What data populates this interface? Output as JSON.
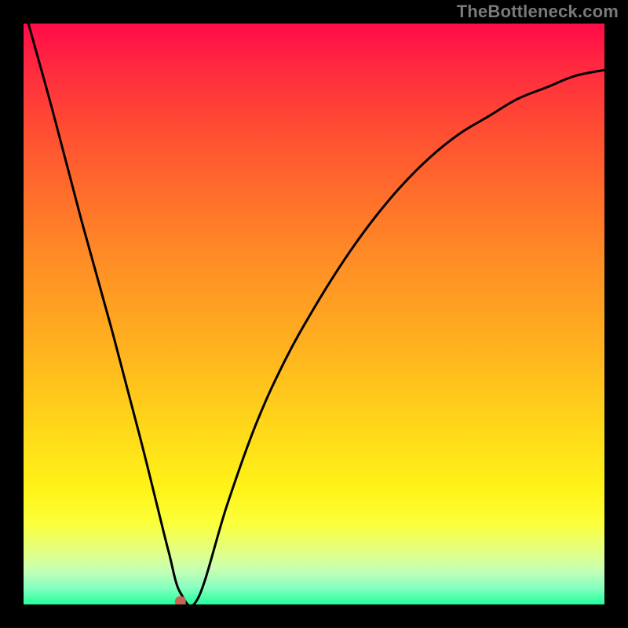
{
  "watermark": "TheBottleneck.com",
  "colors": {
    "background": "#000000",
    "curve": "#000000",
    "marker": "#c96255",
    "watermark_text": "#7a7a7a",
    "gradient_stops": [
      "#ff0b49",
      "#ff2b3f",
      "#ff4934",
      "#ff6a2c",
      "#ff8b26",
      "#ffb01f",
      "#ffd31a",
      "#fff318",
      "#fbff3a",
      "#e8ff77",
      "#c8ffb3",
      "#8affc1",
      "#22ff9d"
    ]
  },
  "chart_data": {
    "type": "line",
    "title": "",
    "xlabel": "",
    "ylabel": "",
    "xlim": [
      0,
      100
    ],
    "ylim": [
      0,
      100
    ],
    "grid": false,
    "series": [
      {
        "name": "bottleneck-curve",
        "x": [
          0,
          5,
          10,
          15,
          20,
          23,
          25,
          27,
          30,
          35,
          40,
          45,
          50,
          55,
          60,
          65,
          70,
          75,
          80,
          85,
          90,
          95,
          100
        ],
        "y": [
          103,
          85,
          66,
          48,
          29,
          17,
          9,
          2,
          1,
          17,
          31,
          42,
          51,
          59,
          66,
          72,
          77,
          81,
          84,
          87,
          89,
          91,
          92
        ]
      }
    ],
    "annotations": [
      {
        "name": "marker-dot",
        "x": 27,
        "y": 0.5,
        "color": "#c96255"
      }
    ],
    "notes": "x and y are expressed as percent of plot area (0 at left/bottom, 100 at right/top). No axis ticks or labels are visible in the image; values are estimated from pixel positions."
  }
}
